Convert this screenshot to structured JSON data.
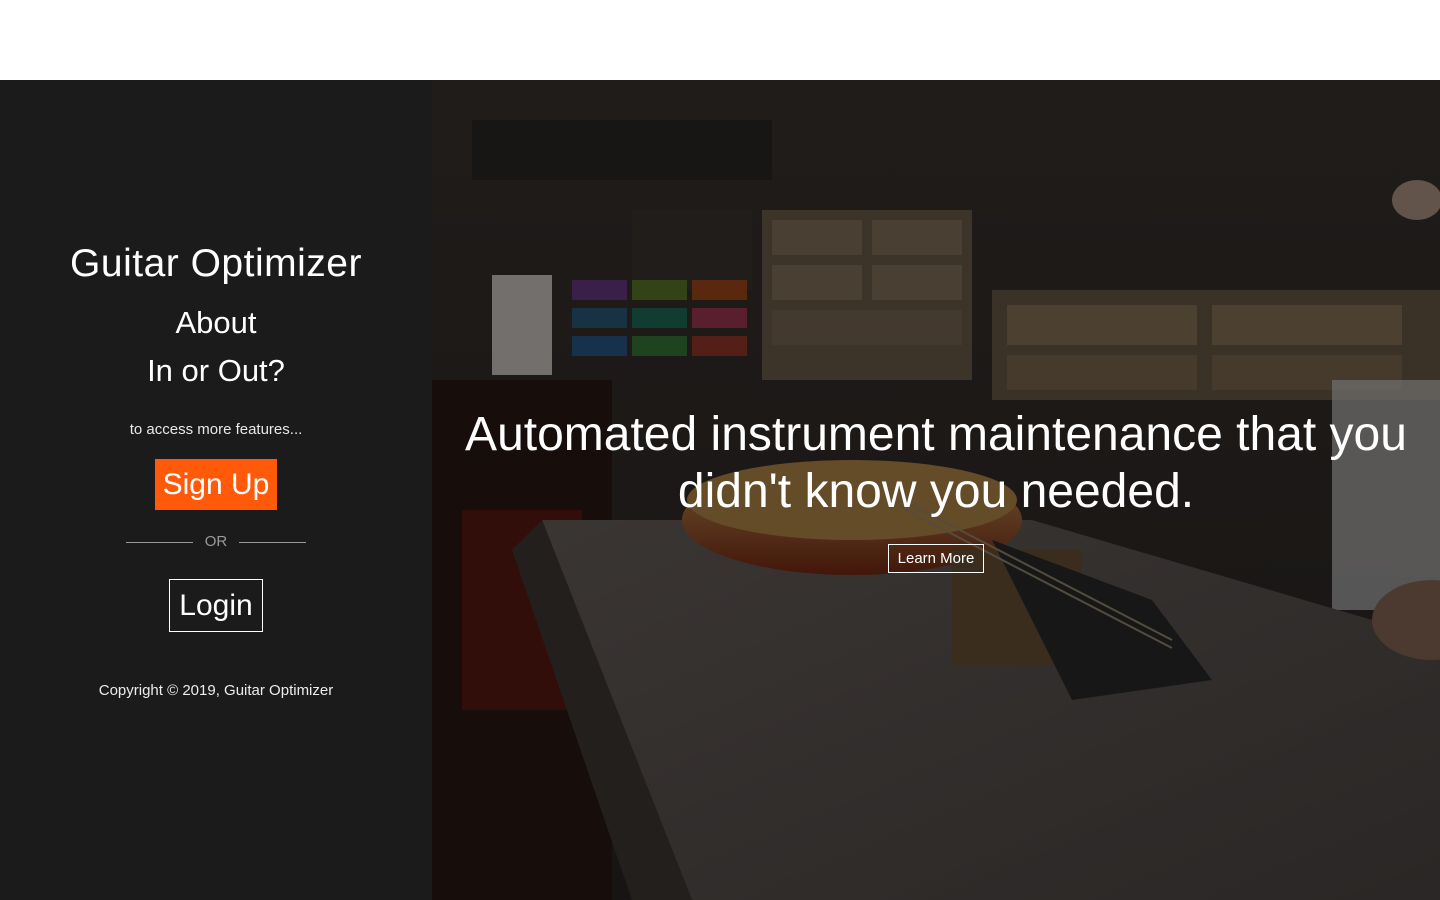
{
  "sidebar": {
    "brand": "Guitar Optimizer",
    "nav": [
      {
        "label": "About"
      },
      {
        "label": "In or Out?"
      }
    ],
    "access_text": "to access more features...",
    "signup_label": "Sign Up",
    "or_text": "OR",
    "login_label": "Login",
    "copyright": "Copyright © 2019, Guitar Optimizer"
  },
  "hero": {
    "headline": "Automated instrument maintenance that you didn't know you needed.",
    "learn_more_label": "Learn More",
    "background_image": "guitar-workshop-photo"
  },
  "colors": {
    "sidebar_bg": "#1b1b1c",
    "accent": "#ff5a0a",
    "text": "#ffffff"
  }
}
